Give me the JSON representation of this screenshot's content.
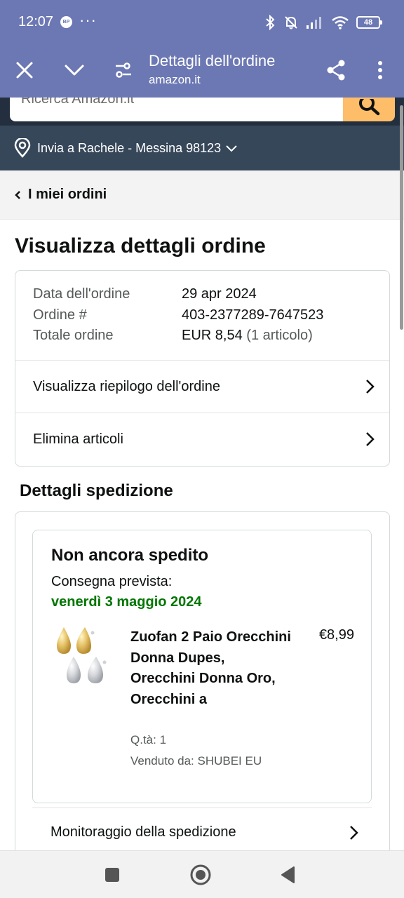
{
  "status_bar": {
    "time": "12:07",
    "badge": "BP",
    "dots": "···",
    "battery": "48"
  },
  "toolbar": {
    "title": "Dettagli dell'ordine",
    "subtitle": "amazon.it"
  },
  "search": {
    "placeholder": "Ricerca Amazon.it"
  },
  "delivery": {
    "label": "Invia a Rachele - Messina 98123"
  },
  "breadcrumb": {
    "label": "I miei ordini"
  },
  "page_title": "Visualizza dettagli ordine",
  "order_summary": {
    "date_label": "Data dell'ordine",
    "date_value": "29 apr 2024",
    "number_label": "Ordine #",
    "number_value": "403-2377289-7647523",
    "total_label": "Totale ordine",
    "total_value": "EUR 8,54",
    "total_items": "(1 articolo)",
    "links": [
      "Visualizza riepilogo dell'ordine",
      "Elimina articoli"
    ]
  },
  "shipping": {
    "section_title": "Dettagli spedizione",
    "status": "Non ancora spedito",
    "delivery_label": "Consegna prevista:",
    "delivery_date": "venerdì 3 maggio 2024",
    "product": {
      "title": "Zuofan 2 Paio Orecchini Donna Dupes, Orecchini Donna Oro, Orecchini a",
      "price": "€8,99",
      "qty": "Q.tà: 1",
      "seller": "Venduto da: SHUBEI EU"
    },
    "tracking_link": "Monitoraggio della spedizione"
  },
  "colors": {
    "header": "#6c78b3",
    "amazon_dark": "#232f3e",
    "delivery_bar": "#37475a",
    "search_button": "#febd69",
    "delivery_green": "#007600"
  }
}
